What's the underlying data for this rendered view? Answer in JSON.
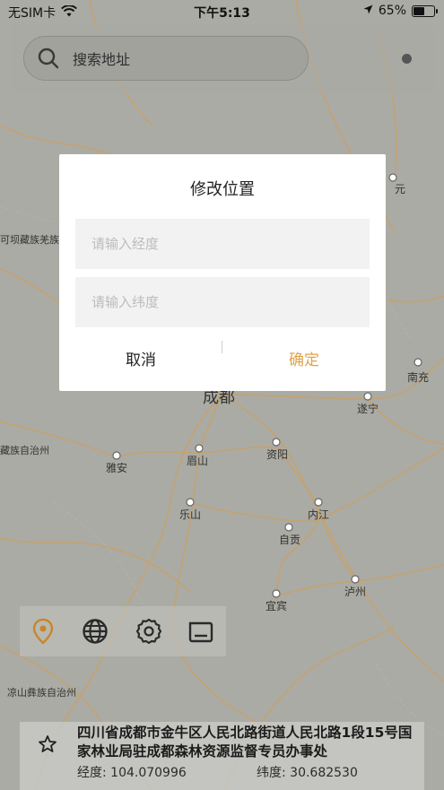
{
  "status_bar": {
    "carrier": "无SIM卡",
    "time": "下午5:13",
    "battery_percent": "65%",
    "battery_level": 0.65
  },
  "search": {
    "placeholder": "搜索地址"
  },
  "dialog": {
    "title": "修改位置",
    "longitude_placeholder": "请输入经度",
    "latitude_placeholder": "请输入纬度",
    "cancel_label": "取消",
    "confirm_label": "确定"
  },
  "map": {
    "labels": [
      {
        "text": "成都"
      },
      {
        "text": "元"
      },
      {
        "text": "南充"
      },
      {
        "text": "遂宁"
      },
      {
        "text": "眉山"
      },
      {
        "text": "资阳"
      },
      {
        "text": "雅安"
      },
      {
        "text": "乐山"
      },
      {
        "text": "内江"
      },
      {
        "text": "自贡"
      },
      {
        "text": "泸州"
      },
      {
        "text": "宜宾"
      },
      {
        "text": "可坝藏族羌族"
      },
      {
        "text": "藏族自治州"
      },
      {
        "text": "凉山彝族自治州"
      }
    ]
  },
  "toolbar": {
    "icons": [
      "location-pin-icon",
      "globe-icon",
      "gear-icon",
      "folder-icon"
    ],
    "active_color": "#c8862a"
  },
  "info": {
    "address": "四川省成都市金牛区人民北路街道人民北路1段15号国家林业局驻成都森林资源监督专员办事处",
    "longitude": "经度: 104.070996",
    "latitude": "纬度: 30.682530"
  },
  "colors": {
    "accent": "#e0a34a",
    "road": "#c9a36a"
  }
}
